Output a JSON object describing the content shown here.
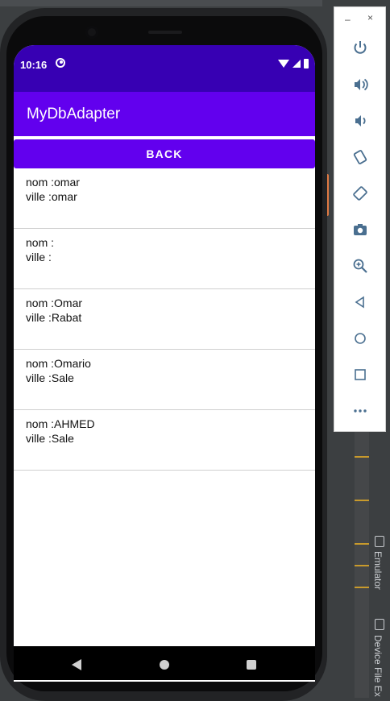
{
  "status_bar": {
    "time": "10:16"
  },
  "app_bar": {
    "title": "MyDbAdapter"
  },
  "back_button": {
    "label": "BACK"
  },
  "list": {
    "items": [
      {
        "nom": "nom :omar",
        "ville": "ville :omar"
      },
      {
        "nom": "nom :",
        "ville": "ville :"
      },
      {
        "nom": "nom :Omar",
        "ville": "ville :Rabat"
      },
      {
        "nom": "nom :Omario",
        "ville": "ville :Sale"
      },
      {
        "nom": "nom :AHMED",
        "ville": "ville :Sale"
      }
    ]
  },
  "ide": {
    "emulator_tab": "Emulator",
    "device_file_tab": "Device File Ex"
  },
  "tool_window": {
    "min_label": "–",
    "close_label": "×",
    "buttons": [
      "power-icon",
      "volume-up-icon",
      "volume-down-icon",
      "rotate-left-icon",
      "rotate-right-icon",
      "camera-icon",
      "zoom-icon",
      "back-icon",
      "home-icon",
      "overview-icon",
      "more-icon"
    ]
  },
  "colors": {
    "status_bar": "#3700b3",
    "primary": "#6200ee"
  }
}
